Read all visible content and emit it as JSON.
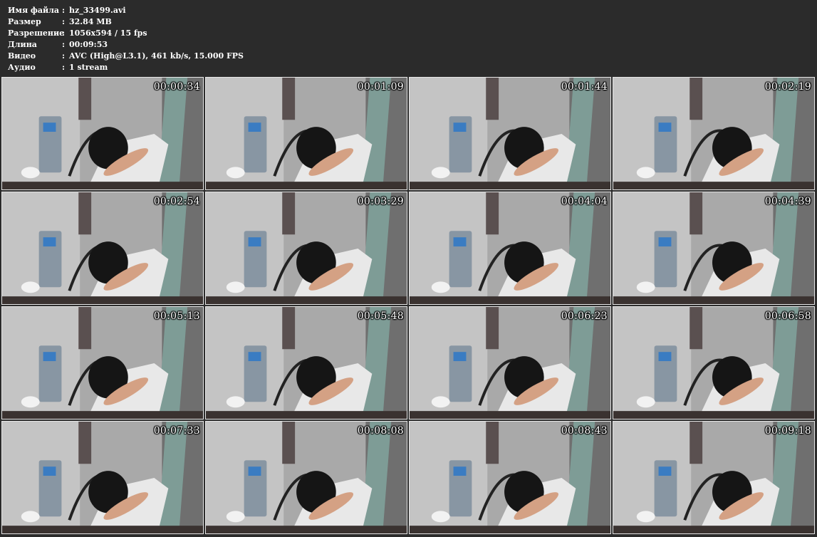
{
  "file_info": [
    {
      "key": "Имя файла",
      "sep": ":",
      "value": "hz_33499.avi"
    },
    {
      "key": "Размер",
      "sep": ":",
      "value": "32.84 MB"
    },
    {
      "key": "Разрешение",
      "sep": ":",
      "value": "1056x594 / 15 fps"
    },
    {
      "key": "Длина",
      "sep": ":",
      "value": "00:09:53"
    },
    {
      "key": "Видео",
      "sep": ":",
      "value": "AVC (High@L3.1), 461 kb/s, 15.000 FPS"
    },
    {
      "key": "Аудио",
      "sep": ":",
      "value": "1 stream"
    }
  ],
  "thumbnails": [
    {
      "timestamp": "00:00:34"
    },
    {
      "timestamp": "00:01:09"
    },
    {
      "timestamp": "00:01:44"
    },
    {
      "timestamp": "00:02:19"
    },
    {
      "timestamp": "00:02:54"
    },
    {
      "timestamp": "00:03:29"
    },
    {
      "timestamp": "00:04:04"
    },
    {
      "timestamp": "00:04:39"
    },
    {
      "timestamp": "00:05:13"
    },
    {
      "timestamp": "00:05:48"
    },
    {
      "timestamp": "00:06:23"
    },
    {
      "timestamp": "00:06:58"
    },
    {
      "timestamp": "00:07:33"
    },
    {
      "timestamp": "00:08:08"
    },
    {
      "timestamp": "00:08:43"
    },
    {
      "timestamp": "00:09:18"
    }
  ],
  "colors": {
    "background": "#2b2b2b",
    "text": "#ffffff"
  }
}
